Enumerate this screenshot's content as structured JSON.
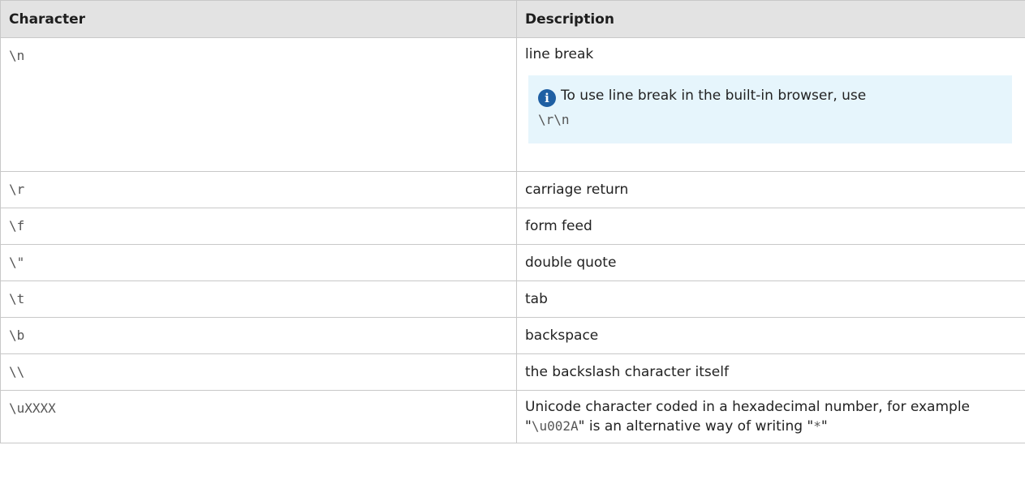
{
  "table": {
    "headers": [
      "Character",
      "Description"
    ],
    "first_row": {
      "character": "\\n",
      "description": "line break",
      "note": {
        "icon": "info-icon",
        "text": "To use line break in the built-in browser, use",
        "code": "\\r\\n"
      }
    },
    "rows": [
      {
        "character": "\\r",
        "description": "carriage return"
      },
      {
        "character": "\\f",
        "description": "form feed"
      },
      {
        "character": "\\\"",
        "description": "double quote"
      },
      {
        "character": "\\t",
        "description": "tab"
      },
      {
        "character": "\\b",
        "description": "backspace"
      },
      {
        "character": "\\\\",
        "description": "the backslash character itself"
      }
    ],
    "last_row": {
      "character": "\\uXXXX",
      "desc_part1": "Unicode character coded in a hexadecimal number, for example \"",
      "desc_code1": "\\u002A",
      "desc_part2": "\" is an alternative way of writing \"",
      "desc_code2": "*",
      "desc_part3": "\""
    }
  },
  "colors": {
    "header_bg": "#e3e3e3",
    "border": "#c8c8c8",
    "note_bg": "#e6f5fc",
    "info_icon": "#1f5fa3"
  }
}
